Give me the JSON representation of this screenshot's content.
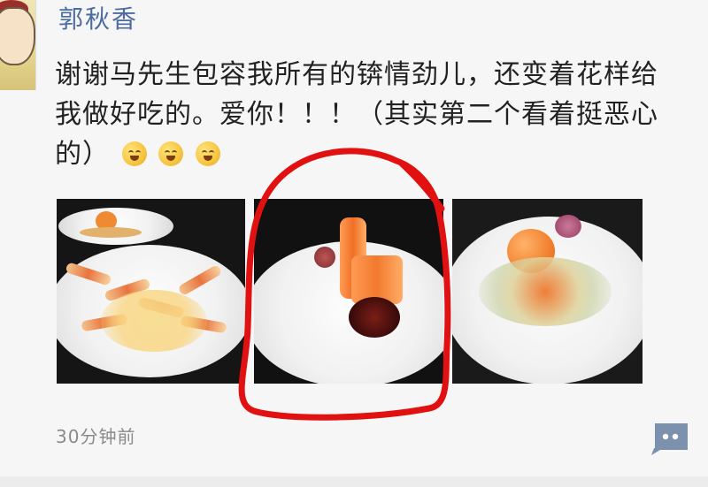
{
  "post": {
    "username": "郭秋香",
    "text": "谢谢马先生包容我所有的锛情劲儿，还变着花样给我做好吃的。爱你！！！（其实第二个看着挺恶心的）",
    "timestamp": "30分钟前"
  },
  "icons": {
    "avatar": "avatar-icon",
    "emoji": "laugh-cry-emoji-icon",
    "comment": "comment-dots-icon"
  },
  "colors": {
    "username": "#4c6ca1",
    "text": "#222222",
    "timestamp": "#8a8a8a",
    "comment_button": "#7b91ad",
    "annotation_red": "#e11111"
  },
  "media": {
    "photos": [
      {
        "description": ""
      },
      {
        "description": ""
      },
      {
        "description": ""
      }
    ]
  }
}
